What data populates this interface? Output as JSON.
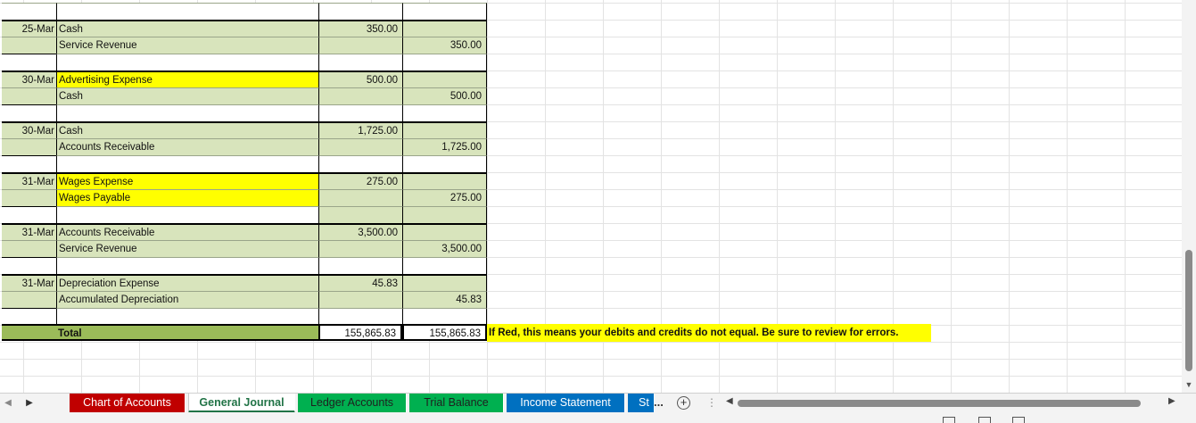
{
  "journal": {
    "entries": [
      {
        "date": "25-Mar",
        "debit_account": "Cash",
        "credit_account": "Service Revenue",
        "debit": "350.00",
        "credit": "350.00",
        "highlight": "none"
      },
      {
        "date": "30-Mar",
        "debit_account": "Advertising Expense",
        "credit_account": "Cash",
        "debit": "500.00",
        "credit": "500.00",
        "highlight": "debit"
      },
      {
        "date": "30-Mar",
        "debit_account": "Cash",
        "credit_account": "Accounts Receivable",
        "debit": "1,725.00",
        "credit": "1,725.00",
        "highlight": "none"
      },
      {
        "date": "31-Mar",
        "debit_account": "Wages Expense",
        "credit_account": "Wages Payable",
        "debit": "275.00",
        "credit": "275.00",
        "highlight": "both"
      },
      {
        "date": "31-Mar",
        "debit_account": "Accounts Receivable",
        "credit_account": "Service Revenue",
        "debit": "3,500.00",
        "credit": "3,500.00",
        "highlight": "none"
      },
      {
        "date": "31-Mar",
        "debit_account": "Depreciation Expense",
        "credit_account": "Accumulated Depreciation",
        "debit": "45.83",
        "credit": "45.83",
        "highlight": "none"
      }
    ],
    "total_label": "Total",
    "total_debit": "155,865.83",
    "total_credit": "155,865.83",
    "note": "If Red, this means your debits and credits do not equal. Be sure to review for errors."
  },
  "tabs": [
    {
      "label": "Chart of Accounts",
      "style": "red"
    },
    {
      "label": "General Journal",
      "style": "active"
    },
    {
      "label": "Ledger Accounts",
      "style": "green"
    },
    {
      "label": "Trial Balance",
      "style": "green"
    },
    {
      "label": "Income Statement",
      "style": "blue"
    },
    {
      "label": "St",
      "style": "blue"
    }
  ],
  "tabbar": {
    "more": "...",
    "add": "+",
    "vdots": "⋮"
  },
  "colors": {
    "green": "#d8e4bc",
    "yellow": "#ffff00",
    "total_green": "#9bbb59",
    "tab_red": "#c00000",
    "tab_green": "#00b050",
    "tab_blue": "#0070c0"
  }
}
